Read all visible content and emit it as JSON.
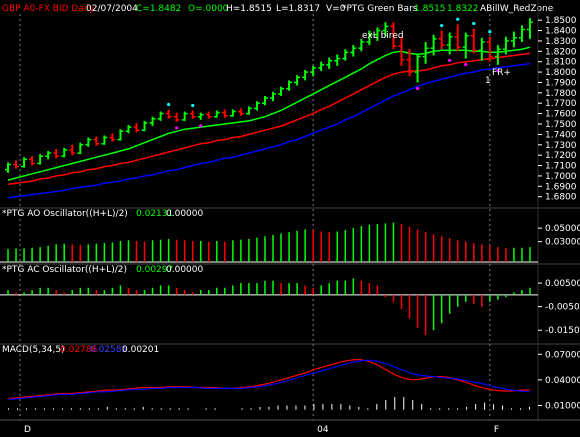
{
  "header": {
    "symbol": "GBP A0-FX BID Daily",
    "date": "02/07/2004",
    "close": "C=1.8482",
    "open": "O=.0000",
    "high": "H=1.8515",
    "low": "L=1.8317",
    "volume": "V=0",
    "study": "*PTG Green Bars",
    "study_v1": "1.8515",
    "study_v2": "1.8322",
    "study2": "ABillW_RedZone"
  },
  "annotations": {
    "exl_bired": "exL bired",
    "fr": "FR+",
    "one": "1"
  },
  "colors": {
    "background": "#000000",
    "green": "#00ff00",
    "red": "#ff0000",
    "blue": "#0000ff",
    "cyan": "#00ffff",
    "magenta": "#ff00ff",
    "white": "#ffffff",
    "yellow": "#ffff00"
  },
  "panels": [
    {
      "id": "price",
      "title": "GBP A0-FX BID Daily",
      "y_ticks": [
        "1.8500",
        "1.8400",
        "1.8300",
        "1.8200",
        "1.8100",
        "1.8000",
        "1.7900",
        "1.7800",
        "1.7700",
        "1.7600",
        "1.7500",
        "1.7400",
        "1.7300",
        "1.7200",
        "1.7100",
        "1.7000",
        "1.6900",
        "1.6800"
      ],
      "ylim": [
        1.672,
        1.854
      ]
    },
    {
      "id": "ao",
      "title": "*PTG AO Oscillator((H+L)/2)",
      "value1": "0.02131",
      "value2": "0.00000",
      "y_ticks": [
        "0.05000",
        "0.03000"
      ]
    },
    {
      "id": "ac",
      "title": "*PTG AC Oscillator((H+L)/2)",
      "value1": "0.00297",
      "value2": "0.00000",
      "y_ticks": [
        "0.00500",
        "-0.00500",
        "-0.01500"
      ]
    },
    {
      "id": "macd",
      "title": "MACD(5,34,5)",
      "value1": "0.02786",
      "value2": "0.02585",
      "value3": "0.00201",
      "y_ticks": [
        "0.07000",
        "0.04000",
        "0.01000"
      ]
    }
  ],
  "x_ticks": [
    "D",
    "04",
    "F"
  ],
  "chart_data": [
    {
      "type": "candlestick",
      "title": "GBP A0-FX BID Daily",
      "ylim": [
        1.672,
        1.854
      ],
      "bars": [
        {
          "o": 1.706,
          "h": 1.713,
          "l": 1.703,
          "c": 1.711
        },
        {
          "o": 1.711,
          "h": 1.715,
          "l": 1.707,
          "c": 1.709
        },
        {
          "o": 1.709,
          "h": 1.718,
          "l": 1.708,
          "c": 1.716
        },
        {
          "o": 1.716,
          "h": 1.719,
          "l": 1.71,
          "c": 1.712
        },
        {
          "o": 1.712,
          "h": 1.721,
          "l": 1.711,
          "c": 1.719
        },
        {
          "o": 1.719,
          "h": 1.724,
          "l": 1.716,
          "c": 1.722
        },
        {
          "o": 1.722,
          "h": 1.726,
          "l": 1.717,
          "c": 1.719
        },
        {
          "o": 1.719,
          "h": 1.727,
          "l": 1.718,
          "c": 1.725
        },
        {
          "o": 1.725,
          "h": 1.73,
          "l": 1.72,
          "c": 1.722
        },
        {
          "o": 1.722,
          "h": 1.732,
          "l": 1.721,
          "c": 1.73
        },
        {
          "o": 1.73,
          "h": 1.737,
          "l": 1.728,
          "c": 1.735
        },
        {
          "o": 1.735,
          "h": 1.738,
          "l": 1.729,
          "c": 1.731
        },
        {
          "o": 1.731,
          "h": 1.739,
          "l": 1.73,
          "c": 1.737
        },
        {
          "o": 1.737,
          "h": 1.741,
          "l": 1.733,
          "c": 1.735
        },
        {
          "o": 1.735,
          "h": 1.745,
          "l": 1.734,
          "c": 1.743
        },
        {
          "o": 1.743,
          "h": 1.749,
          "l": 1.741,
          "c": 1.747
        },
        {
          "o": 1.747,
          "h": 1.751,
          "l": 1.742,
          "c": 1.744
        },
        {
          "o": 1.744,
          "h": 1.753,
          "l": 1.743,
          "c": 1.751
        },
        {
          "o": 1.751,
          "h": 1.757,
          "l": 1.748,
          "c": 1.755
        },
        {
          "o": 1.755,
          "h": 1.762,
          "l": 1.753,
          "c": 1.76
        },
        {
          "o": 1.76,
          "h": 1.764,
          "l": 1.755,
          "c": 1.757
        },
        {
          "o": 1.757,
          "h": 1.761,
          "l": 1.752,
          "c": 1.754
        },
        {
          "o": 1.754,
          "h": 1.762,
          "l": 1.753,
          "c": 1.76
        },
        {
          "o": 1.76,
          "h": 1.763,
          "l": 1.755,
          "c": 1.757
        },
        {
          "o": 1.757,
          "h": 1.761,
          "l": 1.754,
          "c": 1.759
        },
        {
          "o": 1.759,
          "h": 1.762,
          "l": 1.755,
          "c": 1.757
        },
        {
          "o": 1.757,
          "h": 1.763,
          "l": 1.756,
          "c": 1.761
        },
        {
          "o": 1.761,
          "h": 1.764,
          "l": 1.756,
          "c": 1.758
        },
        {
          "o": 1.758,
          "h": 1.764,
          "l": 1.757,
          "c": 1.762
        },
        {
          "o": 1.762,
          "h": 1.765,
          "l": 1.758,
          "c": 1.76
        },
        {
          "o": 1.76,
          "h": 1.767,
          "l": 1.759,
          "c": 1.765
        },
        {
          "o": 1.765,
          "h": 1.772,
          "l": 1.763,
          "c": 1.77
        },
        {
          "o": 1.77,
          "h": 1.777,
          "l": 1.768,
          "c": 1.775
        },
        {
          "o": 1.775,
          "h": 1.781,
          "l": 1.772,
          "c": 1.779
        },
        {
          "o": 1.779,
          "h": 1.786,
          "l": 1.777,
          "c": 1.784
        },
        {
          "o": 1.784,
          "h": 1.792,
          "l": 1.782,
          "c": 1.79
        },
        {
          "o": 1.79,
          "h": 1.797,
          "l": 1.787,
          "c": 1.795
        },
        {
          "o": 1.795,
          "h": 1.802,
          "l": 1.792,
          "c": 1.8
        },
        {
          "o": 1.8,
          "h": 1.806,
          "l": 1.796,
          "c": 1.804
        },
        {
          "o": 1.804,
          "h": 1.81,
          "l": 1.801,
          "c": 1.807
        },
        {
          "o": 1.807,
          "h": 1.814,
          "l": 1.803,
          "c": 1.811
        },
        {
          "o": 1.811,
          "h": 1.817,
          "l": 1.806,
          "c": 1.813
        },
        {
          "o": 1.813,
          "h": 1.822,
          "l": 1.811,
          "c": 1.819
        },
        {
          "o": 1.819,
          "h": 1.826,
          "l": 1.815,
          "c": 1.823
        },
        {
          "o": 1.823,
          "h": 1.832,
          "l": 1.82,
          "c": 1.829
        },
        {
          "o": 1.829,
          "h": 1.84,
          "l": 1.826,
          "c": 1.836
        },
        {
          "o": 1.836,
          "h": 1.843,
          "l": 1.83,
          "c": 1.84
        },
        {
          "o": 1.84,
          "h": 1.848,
          "l": 1.834,
          "c": 1.844
        },
        {
          "o": 1.844,
          "h": 1.848,
          "l": 1.822,
          "c": 1.825
        },
        {
          "o": 1.825,
          "h": 1.834,
          "l": 1.806,
          "c": 1.812
        },
        {
          "o": 1.812,
          "h": 1.822,
          "l": 1.796,
          "c": 1.8
        },
        {
          "o": 1.8,
          "h": 1.818,
          "l": 1.79,
          "c": 1.815
        },
        {
          "o": 1.815,
          "h": 1.829,
          "l": 1.808,
          "c": 1.823
        },
        {
          "o": 1.823,
          "h": 1.836,
          "l": 1.816,
          "c": 1.832
        },
        {
          "o": 1.832,
          "h": 1.84,
          "l": 1.822,
          "c": 1.826
        },
        {
          "o": 1.826,
          "h": 1.838,
          "l": 1.817,
          "c": 1.834
        },
        {
          "o": 1.834,
          "h": 1.846,
          "l": 1.82,
          "c": 1.824
        },
        {
          "o": 1.824,
          "h": 1.838,
          "l": 1.813,
          "c": 1.835
        },
        {
          "o": 1.835,
          "h": 1.842,
          "l": 1.818,
          "c": 1.821
        },
        {
          "o": 1.821,
          "h": 1.833,
          "l": 1.811,
          "c": 1.829
        },
        {
          "o": 1.829,
          "h": 1.834,
          "l": 1.81,
          "c": 1.815
        },
        {
          "o": 1.815,
          "h": 1.826,
          "l": 1.807,
          "c": 1.822
        },
        {
          "o": 1.822,
          "h": 1.834,
          "l": 1.817,
          "c": 1.83
        },
        {
          "o": 1.83,
          "h": 1.839,
          "l": 1.824,
          "c": 1.833
        },
        {
          "o": 1.833,
          "h": 1.845,
          "l": 1.829,
          "c": 1.841
        },
        {
          "o": 1.841,
          "h": 1.852,
          "l": 1.832,
          "c": 1.848
        }
      ],
      "series": [
        {
          "values": [
            1.696,
            1.698,
            1.7,
            1.702,
            1.704,
            1.706,
            1.708,
            1.71,
            1.712,
            1.714,
            1.716,
            1.718,
            1.72,
            1.722,
            1.724,
            1.726,
            1.729,
            1.732,
            1.735,
            1.738,
            1.741,
            1.743,
            1.745,
            1.746,
            1.747,
            1.748,
            1.749,
            1.75,
            1.751,
            1.752,
            1.753,
            1.755,
            1.757,
            1.76,
            1.763,
            1.767,
            1.771,
            1.775,
            1.779,
            1.783,
            1.787,
            1.791,
            1.795,
            1.799,
            1.803,
            1.808,
            1.812,
            1.816,
            1.819,
            1.82,
            1.818,
            1.817,
            1.818,
            1.82,
            1.821,
            1.821,
            1.821,
            1.821,
            1.82,
            1.82,
            1.819,
            1.819,
            1.82,
            1.821,
            1.822,
            1.824
          ]
        },
        {
          "values": [
            1.692,
            1.693,
            1.694,
            1.695,
            1.697,
            1.698,
            1.7,
            1.701,
            1.703,
            1.704,
            1.706,
            1.707,
            1.709,
            1.71,
            1.712,
            1.713,
            1.715,
            1.717,
            1.719,
            1.721,
            1.723,
            1.725,
            1.727,
            1.729,
            1.731,
            1.732,
            1.734,
            1.735,
            1.737,
            1.738,
            1.74,
            1.742,
            1.744,
            1.746,
            1.748,
            1.751,
            1.754,
            1.757,
            1.76,
            1.764,
            1.767,
            1.771,
            1.775,
            1.779,
            1.783,
            1.787,
            1.791,
            1.795,
            1.798,
            1.8,
            1.801,
            1.801,
            1.802,
            1.804,
            1.806,
            1.807,
            1.809,
            1.81,
            1.811,
            1.812,
            1.813,
            1.814,
            1.815,
            1.816,
            1.817,
            1.818
          ]
        },
        {
          "values": [
            1.679,
            1.68,
            1.681,
            1.682,
            1.683,
            1.684,
            1.685,
            1.686,
            1.688,
            1.689,
            1.69,
            1.691,
            1.693,
            1.694,
            1.695,
            1.697,
            1.698,
            1.7,
            1.701,
            1.703,
            1.705,
            1.706,
            1.708,
            1.71,
            1.712,
            1.713,
            1.715,
            1.717,
            1.718,
            1.72,
            1.722,
            1.724,
            1.726,
            1.728,
            1.73,
            1.733,
            1.735,
            1.738,
            1.741,
            1.744,
            1.747,
            1.75,
            1.754,
            1.757,
            1.761,
            1.765,
            1.769,
            1.773,
            1.777,
            1.78,
            1.783,
            1.786,
            1.789,
            1.791,
            1.793,
            1.795,
            1.797,
            1.799,
            1.8,
            1.802,
            1.803,
            1.804,
            1.805,
            1.806,
            1.807,
            1.808
          ]
        }
      ]
    },
    {
      "type": "bar",
      "title": "*PTG AO Oscillator((H+L)/2)",
      "ylim": [
        0,
        0.062
      ],
      "values": [
        0.019,
        0.02,
        0.02,
        0.021,
        0.022,
        0.024,
        0.026,
        0.027,
        0.026,
        0.025,
        0.026,
        0.027,
        0.028,
        0.029,
        0.031,
        0.032,
        0.031,
        0.03,
        0.032,
        0.033,
        0.034,
        0.033,
        0.032,
        0.031,
        0.031,
        0.03,
        0.031,
        0.03,
        0.032,
        0.033,
        0.034,
        0.036,
        0.038,
        0.04,
        0.042,
        0.044,
        0.046,
        0.048,
        0.047,
        0.045,
        0.044,
        0.045,
        0.047,
        0.05,
        0.053,
        0.055,
        0.056,
        0.057,
        0.058,
        0.056,
        0.052,
        0.048,
        0.044,
        0.041,
        0.038,
        0.035,
        0.032,
        0.03,
        0.028,
        0.026,
        0.024,
        0.022,
        0.021,
        0.021,
        0.021,
        0.022
      ]
    },
    {
      "type": "bar",
      "title": "*PTG AC Oscillator((H+L)/2)",
      "ylim": [
        -0.02,
        0.008
      ],
      "values": [
        0.002,
        0.001,
        0.001,
        0.002,
        0.003,
        0.003,
        0.002,
        0.001,
        0.002,
        0.003,
        0.003,
        0.002,
        0.002,
        0.003,
        0.004,
        0.003,
        0.002,
        0.002,
        0.003,
        0.004,
        0.004,
        0.003,
        0.002,
        0.001,
        0.002,
        0.002,
        0.003,
        0.003,
        0.004,
        0.005,
        0.005,
        0.005,
        0.006,
        0.006,
        0.005,
        0.005,
        0.005,
        0.004,
        0.003,
        0.004,
        0.005,
        0.006,
        0.006,
        0.007,
        0.006,
        0.005,
        0.004,
        -0.001,
        -0.003,
        -0.006,
        -0.01,
        -0.014,
        -0.017,
        -0.015,
        -0.012,
        -0.008,
        -0.005,
        -0.003,
        -0.004,
        -0.005,
        -0.003,
        -0.002,
        -0.001,
        0.001,
        0.002,
        0.003
      ]
    },
    {
      "type": "line",
      "title": "MACD(5,34,5)",
      "ylim": [
        0,
        0.075
      ],
      "series": [
        {
          "values": [
            0.018,
            0.019,
            0.02,
            0.021,
            0.022,
            0.023,
            0.024,
            0.024,
            0.025,
            0.026,
            0.027,
            0.028,
            0.028,
            0.029,
            0.03,
            0.031,
            0.031,
            0.031,
            0.032,
            0.032,
            0.032,
            0.031,
            0.031,
            0.031,
            0.03,
            0.03,
            0.031,
            0.032,
            0.034,
            0.036,
            0.039,
            0.042,
            0.045,
            0.048,
            0.052,
            0.055,
            0.058,
            0.061,
            0.063,
            0.064,
            0.062,
            0.058,
            0.052,
            0.046,
            0.042,
            0.04,
            0.041,
            0.043,
            0.044,
            0.043,
            0.04,
            0.037,
            0.033,
            0.03,
            0.028,
            0.027,
            0.027,
            0.028,
            0.028
          ]
        },
        {
          "values": [
            0.017,
            0.018,
            0.019,
            0.02,
            0.021,
            0.022,
            0.023,
            0.023,
            0.024,
            0.025,
            0.026,
            0.026,
            0.027,
            0.028,
            0.029,
            0.029,
            0.03,
            0.03,
            0.031,
            0.031,
            0.031,
            0.031,
            0.03,
            0.03,
            0.03,
            0.03,
            0.03,
            0.031,
            0.032,
            0.034,
            0.036,
            0.039,
            0.042,
            0.045,
            0.048,
            0.051,
            0.054,
            0.057,
            0.06,
            0.062,
            0.063,
            0.062,
            0.059,
            0.055,
            0.051,
            0.047,
            0.045,
            0.044,
            0.043,
            0.042,
            0.041,
            0.039,
            0.037,
            0.035,
            0.032,
            0.03,
            0.028,
            0.027,
            0.026
          ]
        },
        {
          "values": [
            0.001,
            0.001,
            0.001,
            0.001,
            0.001,
            0.001,
            0.001,
            0.001,
            0.001,
            0.001,
            0.001,
            0.002,
            0.001,
            0.001,
            0.001,
            0.002,
            0.001,
            0.001,
            0.001,
            0.001,
            0.001,
            0.0,
            0.001,
            0.001,
            0.0,
            0.0,
            0.001,
            0.001,
            0.002,
            0.002,
            0.003,
            0.003,
            0.003,
            0.003,
            0.004,
            0.004,
            0.004,
            0.004,
            0.003,
            0.002,
            -0.001,
            -0.004,
            -0.007,
            -0.009,
            -0.009,
            -0.007,
            -0.004,
            -0.001,
            0.001,
            0.001,
            -0.001,
            -0.002,
            -0.004,
            -0.005,
            -0.004,
            -0.003,
            -0.001,
            0.001,
            0.002
          ]
        }
      ]
    }
  ]
}
